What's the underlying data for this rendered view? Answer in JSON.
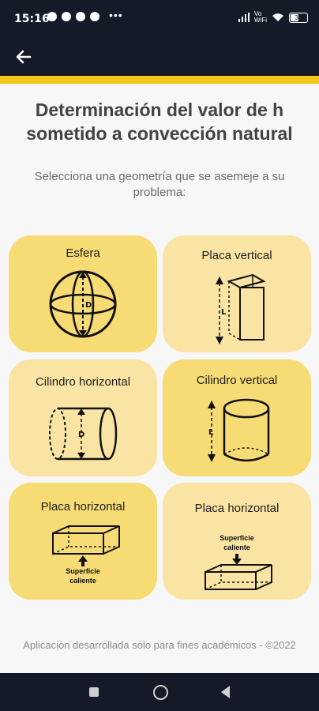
{
  "status_bar": {
    "time": "15:16",
    "network": "Vo\nWiFi",
    "battery": "31"
  },
  "header": {
    "back_icon": "arrow-left-icon",
    "accent_color": "#f3c61c",
    "bar_color": "#141a28"
  },
  "main": {
    "title": "Determinación del valor de h sometido a convección natural",
    "subtitle": "Selecciona una geometría que se asemeje a su problema:"
  },
  "geometries": [
    {
      "label": "Esfera",
      "dimension": "D"
    },
    {
      "label": "Placa vertical",
      "dimension": "L"
    },
    {
      "label": "Cilindro horizontal",
      "dimension": "D"
    },
    {
      "label": "Cilindro vertical",
      "dimension": "L"
    },
    {
      "label": "Placa horizontal",
      "note": "Superficie caliente"
    },
    {
      "label": "Placa horizontal",
      "note": "Superficie caliente"
    }
  ],
  "footer": {
    "text": "Aplicación desarrollada sólo para fines académicos -  ©2022"
  }
}
